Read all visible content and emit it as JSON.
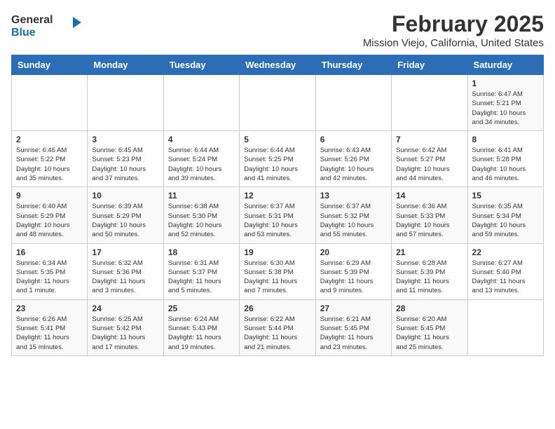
{
  "header": {
    "logo": {
      "general": "General",
      "blue": "Blue"
    },
    "title": "February 2025",
    "subtitle": "Mission Viejo, California, United States"
  },
  "calendar": {
    "days_of_week": [
      "Sunday",
      "Monday",
      "Tuesday",
      "Wednesday",
      "Thursday",
      "Friday",
      "Saturday"
    ],
    "weeks": [
      [
        {
          "day": "",
          "info": ""
        },
        {
          "day": "",
          "info": ""
        },
        {
          "day": "",
          "info": ""
        },
        {
          "day": "",
          "info": ""
        },
        {
          "day": "",
          "info": ""
        },
        {
          "day": "",
          "info": ""
        },
        {
          "day": "1",
          "info": "Sunrise: 6:47 AM\nSunset: 5:21 PM\nDaylight: 10 hours\nand 34 minutes."
        }
      ],
      [
        {
          "day": "2",
          "info": "Sunrise: 6:46 AM\nSunset: 5:22 PM\nDaylight: 10 hours\nand 35 minutes."
        },
        {
          "day": "3",
          "info": "Sunrise: 6:45 AM\nSunset: 5:23 PM\nDaylight: 10 hours\nand 37 minutes."
        },
        {
          "day": "4",
          "info": "Sunrise: 6:44 AM\nSunset: 5:24 PM\nDaylight: 10 hours\nand 39 minutes."
        },
        {
          "day": "5",
          "info": "Sunrise: 6:44 AM\nSunset: 5:25 PM\nDaylight: 10 hours\nand 41 minutes."
        },
        {
          "day": "6",
          "info": "Sunrise: 6:43 AM\nSunset: 5:26 PM\nDaylight: 10 hours\nand 42 minutes."
        },
        {
          "day": "7",
          "info": "Sunrise: 6:42 AM\nSunset: 5:27 PM\nDaylight: 10 hours\nand 44 minutes."
        },
        {
          "day": "8",
          "info": "Sunrise: 6:41 AM\nSunset: 5:28 PM\nDaylight: 10 hours\nand 46 minutes."
        }
      ],
      [
        {
          "day": "9",
          "info": "Sunrise: 6:40 AM\nSunset: 5:29 PM\nDaylight: 10 hours\nand 48 minutes."
        },
        {
          "day": "10",
          "info": "Sunrise: 6:39 AM\nSunset: 5:29 PM\nDaylight: 10 hours\nand 50 minutes."
        },
        {
          "day": "11",
          "info": "Sunrise: 6:38 AM\nSunset: 5:30 PM\nDaylight: 10 hours\nand 52 minutes."
        },
        {
          "day": "12",
          "info": "Sunrise: 6:37 AM\nSunset: 5:31 PM\nDaylight: 10 hours\nand 53 minutes."
        },
        {
          "day": "13",
          "info": "Sunrise: 6:37 AM\nSunset: 5:32 PM\nDaylight: 10 hours\nand 55 minutes."
        },
        {
          "day": "14",
          "info": "Sunrise: 6:36 AM\nSunset: 5:33 PM\nDaylight: 10 hours\nand 57 minutes."
        },
        {
          "day": "15",
          "info": "Sunrise: 6:35 AM\nSunset: 5:34 PM\nDaylight: 10 hours\nand 59 minutes."
        }
      ],
      [
        {
          "day": "16",
          "info": "Sunrise: 6:34 AM\nSunset: 5:35 PM\nDaylight: 11 hours\nand 1 minute."
        },
        {
          "day": "17",
          "info": "Sunrise: 6:32 AM\nSunset: 5:36 PM\nDaylight: 11 hours\nand 3 minutes."
        },
        {
          "day": "18",
          "info": "Sunrise: 6:31 AM\nSunset: 5:37 PM\nDaylight: 11 hours\nand 5 minutes."
        },
        {
          "day": "19",
          "info": "Sunrise: 6:30 AM\nSunset: 5:38 PM\nDaylight: 11 hours\nand 7 minutes."
        },
        {
          "day": "20",
          "info": "Sunrise: 6:29 AM\nSunset: 5:39 PM\nDaylight: 11 hours\nand 9 minutes."
        },
        {
          "day": "21",
          "info": "Sunrise: 6:28 AM\nSunset: 5:39 PM\nDaylight: 11 hours\nand 11 minutes."
        },
        {
          "day": "22",
          "info": "Sunrise: 6:27 AM\nSunset: 5:40 PM\nDaylight: 11 hours\nand 13 minutes."
        }
      ],
      [
        {
          "day": "23",
          "info": "Sunrise: 6:26 AM\nSunset: 5:41 PM\nDaylight: 11 hours\nand 15 minutes."
        },
        {
          "day": "24",
          "info": "Sunrise: 6:25 AM\nSunset: 5:42 PM\nDaylight: 11 hours\nand 17 minutes."
        },
        {
          "day": "25",
          "info": "Sunrise: 6:24 AM\nSunset: 5:43 PM\nDaylight: 11 hours\nand 19 minutes."
        },
        {
          "day": "26",
          "info": "Sunrise: 6:22 AM\nSunset: 5:44 PM\nDaylight: 11 hours\nand 21 minutes."
        },
        {
          "day": "27",
          "info": "Sunrise: 6:21 AM\nSunset: 5:45 PM\nDaylight: 11 hours\nand 23 minutes."
        },
        {
          "day": "28",
          "info": "Sunrise: 6:20 AM\nSunset: 5:45 PM\nDaylight: 11 hours\nand 25 minutes."
        },
        {
          "day": "",
          "info": ""
        }
      ]
    ]
  }
}
